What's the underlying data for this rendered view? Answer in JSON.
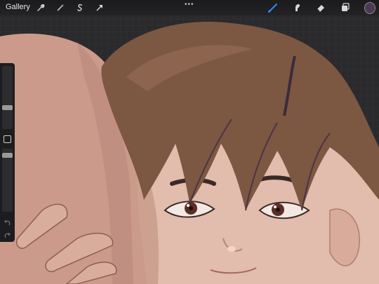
{
  "toolbar": {
    "gallery_label": "Gallery",
    "more_label": "•••",
    "left_tools": [
      "wrench-icon",
      "magic-wand-icon",
      "selection-icon",
      "transform-arrow-icon"
    ],
    "right_tools": [
      "brush-icon",
      "smudge-icon",
      "eraser-icon",
      "layers-icon",
      "color-swatch"
    ],
    "active_tool": "brush",
    "accent_color": "#2f86ff",
    "current_color": "#4a3a52"
  },
  "sidebar": {
    "brush_size_level": 0.42,
    "opacity_level": 0.5,
    "controls": [
      "brush-size-slider",
      "modify-button",
      "opacity-slider",
      "undo-icon",
      "redo-icon"
    ]
  },
  "canvas": {
    "background_color": "#2a2a2c",
    "skin_color": "#d5a89a",
    "hair_color": "#7a5640"
  }
}
